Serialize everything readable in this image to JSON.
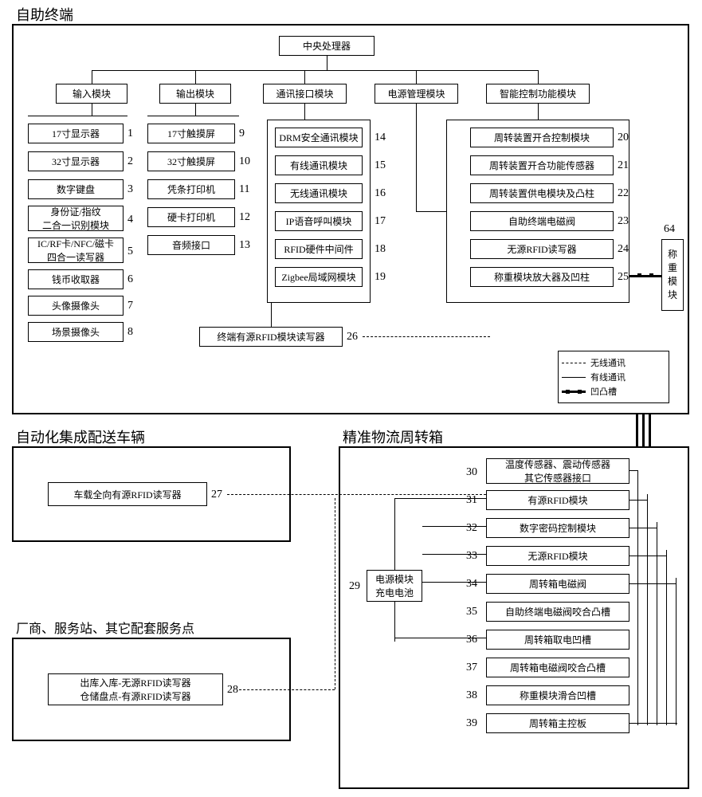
{
  "sections": {
    "terminal": {
      "title": "自助终端"
    },
    "vehicle": {
      "title": "自动化集成配送车辆"
    },
    "factory": {
      "title": "厂商、服务站、其它配套服务点"
    },
    "box": {
      "title": "精准物流周转箱"
    }
  },
  "cpu": "中央处理器",
  "modules": {
    "input": "输入模块",
    "output": "输出模块",
    "comm": "通讯接口模块",
    "power": "电源管理模块",
    "smart": "智能控制功能模块"
  },
  "input_items": {
    "1": "17寸显示器",
    "2": "32寸显示器",
    "3": "数字键盘",
    "4": "身份证/指纹\n二合一识别模块",
    "5": "IC/RF卡/NFC/磁卡\n四合一读写器",
    "6": "钱币收取器",
    "7": "头像摄像头",
    "8": "场景摄像头"
  },
  "output_items": {
    "9": "17寸触摸屏",
    "10": "32寸触摸屏",
    "11": "凭条打印机",
    "12": "硬卡打印机",
    "13": "音频接口"
  },
  "comm_items": {
    "14": "DRM安全通讯模块",
    "15": "有线通讯模块",
    "16": "无线通讯模块",
    "17": "IP语音呼叫模块",
    "18": "RFID硬件中间件",
    "19": "Zigbee局域网模块"
  },
  "smart_items": {
    "20": "周转装置开合控制模块",
    "21": "周转装置开合功能传感器",
    "22": "周转装置供电模块及凸柱",
    "23": "自助终端电磁阀",
    "24": "无源RFID读写器",
    "25": "称重模块放大器及凹柱"
  },
  "terminal_rfid": {
    "num": "26",
    "label": "终端有源RFID模块读写器"
  },
  "vehicle_rfid": {
    "num": "27",
    "label": "车载全向有源RFID读写器"
  },
  "factory_rfid": {
    "num": "28",
    "label": "出库入库-无源RFID读写器\n仓储盘点-有源RFID读写器"
  },
  "powermod": {
    "num": "29",
    "label": "电源模块\n充电电池"
  },
  "box_items": {
    "30": "温度传感器、震动传感器\n其它传感器接口",
    "31": "有源RFID模块",
    "32": "数字密码控制模块",
    "33": "无源RFID模块",
    "34": "周转箱电磁阀",
    "35": "自助终端电磁阀咬合凸槽",
    "36": "周转箱取电凹槽",
    "37": "周转箱电磁阀咬合凸槽",
    "38": "称重模块滑合凹槽",
    "39": "周转箱主控板"
  },
  "weigh": {
    "num": "64",
    "label": "称\n重\n模\n块"
  },
  "legend": {
    "wireless": "无线通讯",
    "wired": "有线通讯",
    "slot": "凹凸槽"
  }
}
